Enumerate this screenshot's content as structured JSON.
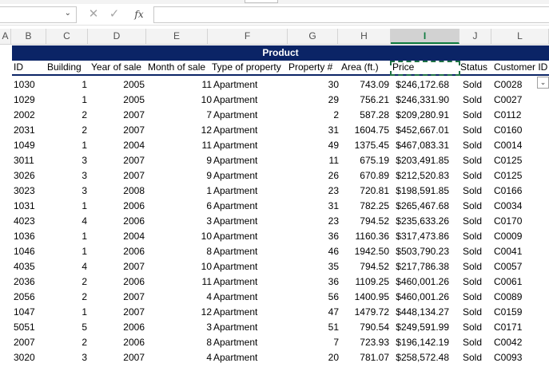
{
  "formula_bar": {
    "namebox_chevron_icon": "chevron-down-icon",
    "cancel_glyph": "✕",
    "enter_glyph": "✓",
    "fx_label": "fx",
    "formula_value": ""
  },
  "columns": [
    "A",
    "B",
    "C",
    "D",
    "E",
    "F",
    "G",
    "H",
    "I",
    "J",
    "L"
  ],
  "selected_column": "I",
  "table": {
    "title": "Product",
    "headers": {
      "id": "ID",
      "building": "Building",
      "year": "Year of sale",
      "month": "Month of sale",
      "type": "Type of property",
      "property_no": "Property #",
      "area": "Area (ft.)",
      "price": "Price",
      "status": "Status",
      "customer": "Customer ID"
    },
    "rows": [
      {
        "id": "1030",
        "building": "1",
        "year": "2005",
        "month": "11",
        "type": "Apartment",
        "prop": "30",
        "area": "743.09",
        "price": "$246,172.68",
        "status": "Sold",
        "cust": "C0028"
      },
      {
        "id": "1029",
        "building": "1",
        "year": "2005",
        "month": "10",
        "type": "Apartment",
        "prop": "29",
        "area": "756.21",
        "price": "$246,331.90",
        "status": "Sold",
        "cust": "C0027"
      },
      {
        "id": "2002",
        "building": "2",
        "year": "2007",
        "month": "7",
        "type": "Apartment",
        "prop": "2",
        "area": "587.28",
        "price": "$209,280.91",
        "status": "Sold",
        "cust": "C0112"
      },
      {
        "id": "2031",
        "building": "2",
        "year": "2007",
        "month": "12",
        "type": "Apartment",
        "prop": "31",
        "area": "1604.75",
        "price": "$452,667.01",
        "status": "Sold",
        "cust": "C0160"
      },
      {
        "id": "1049",
        "building": "1",
        "year": "2004",
        "month": "11",
        "type": "Apartment",
        "prop": "49",
        "area": "1375.45",
        "price": "$467,083.31",
        "status": "Sold",
        "cust": "C0014"
      },
      {
        "id": "3011",
        "building": "3",
        "year": "2007",
        "month": "9",
        "type": "Apartment",
        "prop": "11",
        "area": "675.19",
        "price": "$203,491.85",
        "status": "Sold",
        "cust": "C0125"
      },
      {
        "id": "3026",
        "building": "3",
        "year": "2007",
        "month": "9",
        "type": "Apartment",
        "prop": "26",
        "area": "670.89",
        "price": "$212,520.83",
        "status": "Sold",
        "cust": "C0125"
      },
      {
        "id": "3023",
        "building": "3",
        "year": "2008",
        "month": "1",
        "type": "Apartment",
        "prop": "23",
        "area": "720.81",
        "price": "$198,591.85",
        "status": "Sold",
        "cust": "C0166"
      },
      {
        "id": "1031",
        "building": "1",
        "year": "2006",
        "month": "6",
        "type": "Apartment",
        "prop": "31",
        "area": "782.25",
        "price": "$265,467.68",
        "status": "Sold",
        "cust": "C0034"
      },
      {
        "id": "4023",
        "building": "4",
        "year": "2006",
        "month": "3",
        "type": "Apartment",
        "prop": "23",
        "area": "794.52",
        "price": "$235,633.26",
        "status": "Sold",
        "cust": "C0170"
      },
      {
        "id": "1036",
        "building": "1",
        "year": "2004",
        "month": "10",
        "type": "Apartment",
        "prop": "36",
        "area": "1160.36",
        "price": "$317,473.86",
        "status": "Sold",
        "cust": "C0009"
      },
      {
        "id": "1046",
        "building": "1",
        "year": "2006",
        "month": "8",
        "type": "Apartment",
        "prop": "46",
        "area": "1942.50",
        "price": "$503,790.23",
        "status": "Sold",
        "cust": "C0041"
      },
      {
        "id": "4035",
        "building": "4",
        "year": "2007",
        "month": "10",
        "type": "Apartment",
        "prop": "35",
        "area": "794.52",
        "price": "$217,786.38",
        "status": "Sold",
        "cust": "C0057"
      },
      {
        "id": "2036",
        "building": "2",
        "year": "2006",
        "month": "11",
        "type": "Apartment",
        "prop": "36",
        "area": "1109.25",
        "price": "$460,001.26",
        "status": "Sold",
        "cust": "C0061"
      },
      {
        "id": "2056",
        "building": "2",
        "year": "2007",
        "month": "4",
        "type": "Apartment",
        "prop": "56",
        "area": "1400.95",
        "price": "$460,001.26",
        "status": "Sold",
        "cust": "C0089"
      },
      {
        "id": "1047",
        "building": "1",
        "year": "2007",
        "month": "12",
        "type": "Apartment",
        "prop": "47",
        "area": "1479.72",
        "price": "$448,134.27",
        "status": "Sold",
        "cust": "C0159"
      },
      {
        "id": "5051",
        "building": "5",
        "year": "2006",
        "month": "3",
        "type": "Apartment",
        "prop": "51",
        "area": "790.54",
        "price": "$249,591.99",
        "status": "Sold",
        "cust": "C0171"
      },
      {
        "id": "2007",
        "building": "2",
        "year": "2006",
        "month": "8",
        "type": "Apartment",
        "prop": "7",
        "area": "723.93",
        "price": "$196,142.19",
        "status": "Sold",
        "cust": "C0042"
      },
      {
        "id": "3020",
        "building": "3",
        "year": "2007",
        "month": "4",
        "type": "Apartment",
        "prop": "20",
        "area": "781.07",
        "price": "$258,572.48",
        "status": "Sold",
        "cust": "C0093"
      }
    ]
  }
}
